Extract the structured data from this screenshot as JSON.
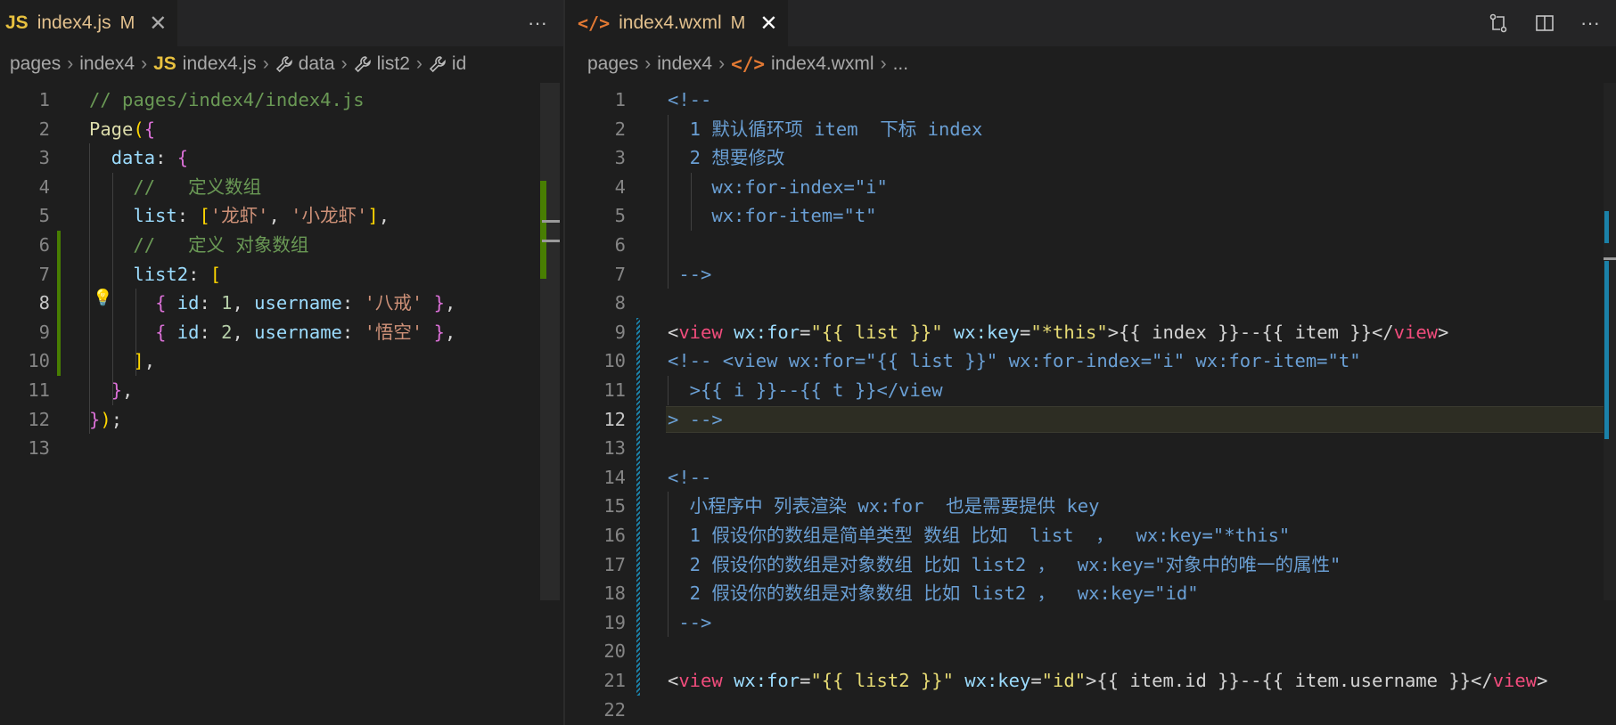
{
  "left": {
    "tab": {
      "icon": "JS",
      "name": "index4.js",
      "status": "M",
      "close": "✕"
    },
    "more": "···",
    "breadcrumb": {
      "items": [
        {
          "label": "pages",
          "icon": ""
        },
        {
          "label": "index4",
          "icon": ""
        },
        {
          "label": "index4.js",
          "icon": "JS"
        },
        {
          "label": "data",
          "icon": "wrench-icon"
        },
        {
          "label": "list2",
          "icon": "wrench-icon"
        },
        {
          "label": "id",
          "icon": "wrench-icon"
        }
      ]
    },
    "current_line": 8,
    "lines": [
      {
        "n": "1",
        "t": "// pages/index4/index4.js"
      },
      {
        "n": "2",
        "t": "Page({"
      },
      {
        "n": "3",
        "t": "  data: {"
      },
      {
        "n": "4",
        "t": "    //   定义数组"
      },
      {
        "n": "5",
        "t": "    list: ['龙虾', '小龙虾'],"
      },
      {
        "n": "6",
        "t": "    //   定义 对象数组"
      },
      {
        "n": "7",
        "t": "    list2: ["
      },
      {
        "n": "8",
        "t": "      { id: 1, username: '八戒' },"
      },
      {
        "n": "9",
        "t": "      { id: 2, username: '悟空' },"
      },
      {
        "n": "10",
        "t": "    ],"
      },
      {
        "n": "11",
        "t": "  },"
      },
      {
        "n": "12",
        "t": "});"
      },
      {
        "n": "13",
        "t": ""
      }
    ]
  },
  "right": {
    "tab": {
      "icon": "</>",
      "name": "index4.wxml",
      "status": "M",
      "close": "✕"
    },
    "actions": [
      "compare-changes-icon",
      "split-editor-icon",
      "more-actions-icon"
    ],
    "more": "···",
    "breadcrumb": {
      "items": [
        {
          "label": "pages",
          "icon": ""
        },
        {
          "label": "index4",
          "icon": ""
        },
        {
          "label": "index4.wxml",
          "icon": "</>"
        },
        {
          "label": "...",
          "icon": ""
        }
      ]
    },
    "current_line": 12,
    "lines": [
      {
        "n": "1",
        "t": "<!--"
      },
      {
        "n": "2",
        "t": "  1 默认循环项 item  下标 index"
      },
      {
        "n": "3",
        "t": "  2 想要修改"
      },
      {
        "n": "4",
        "t": "    wx:for-index=\"i\""
      },
      {
        "n": "5",
        "t": "    wx:for-item=\"t\""
      },
      {
        "n": "6",
        "t": ""
      },
      {
        "n": "7",
        "t": " -->"
      },
      {
        "n": "8",
        "t": ""
      },
      {
        "n": "9",
        "t": "<view wx:for=\"{{ list }}\" wx:key=\"*this\">{{ index }}--{{ item }}</view>"
      },
      {
        "n": "10",
        "t": "<!-- <view wx:for=\"{{ list }}\" wx:for-index=\"i\" wx:for-item=\"t\""
      },
      {
        "n": "11",
        "t": "  >{{ i }}--{{ t }}</view"
      },
      {
        "n": "12",
        "t": "> -->"
      },
      {
        "n": "13",
        "t": ""
      },
      {
        "n": "14",
        "t": "<!--"
      },
      {
        "n": "15",
        "t": "  小程序中 列表渲染 wx:for  也是需要提供 key"
      },
      {
        "n": "16",
        "t": "  1 假设你的数组是简单类型 数组 比如  list  ，  wx:key=\"*this\""
      },
      {
        "n": "17",
        "t": "  2 假设你的数组是对象数组 比如 list2 ，  wx:key=\"对象中的唯一的属性\""
      },
      {
        "n": "18",
        "t": "  2 假设你的数组是对象数组 比如 list2 ，  wx:key=\"id\""
      },
      {
        "n": "19",
        "t": " -->"
      },
      {
        "n": "20",
        "t": ""
      },
      {
        "n": "21",
        "t": "<view wx:for=\"{{ list2 }}\" wx:key=\"id\">{{ item.id }}--{{ item.username }}</view>"
      },
      {
        "n": "22",
        "t": ""
      }
    ]
  }
}
